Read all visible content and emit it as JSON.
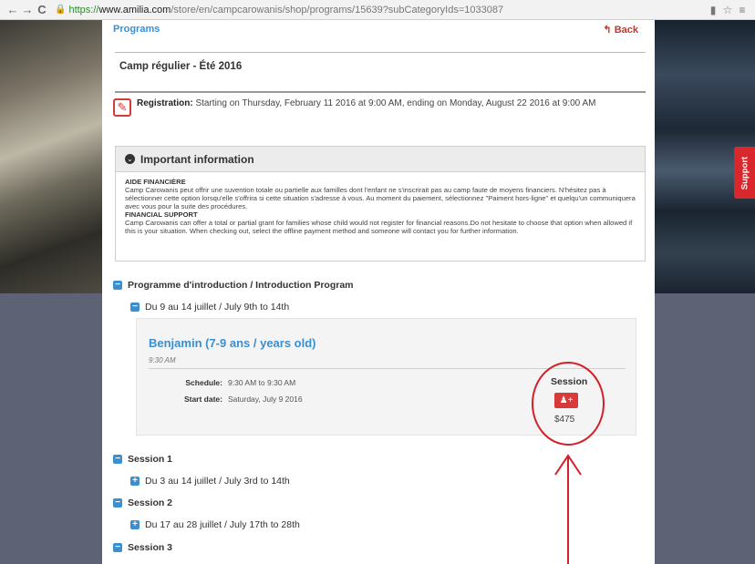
{
  "browser": {
    "back_glyph": "←",
    "forward_glyph": "→",
    "reload_glyph": "C",
    "url_https": "https://",
    "url_host": "www.amilia.com",
    "url_path": "/store/en/campcarowanis/shop/programs/15639?subCategoryIds=1033087",
    "ext_glyph": "▮",
    "star_glyph": "☆",
    "menu_glyph": "≡"
  },
  "page": {
    "programs_link": "Programs",
    "back_link": "↰ Back",
    "camp_title": "Camp régulier - Été 2016",
    "registration_label": "Registration:",
    "registration_text": "Starting on Thursday, February 11 2016 at 9:00 AM, ending on Monday, August 22 2016 at 9:00 AM"
  },
  "important_info": {
    "title": "Important information",
    "heading_fr": "AIDE FINANCIÈRE",
    "text_fr": "Camp Carowanis peut offrir une suvention totale ou partielle aux familles dont l'enfant ne s'inscrirait pas au camp faute de moyens financiers. N'hésitez pas à sélectionner cette option lorsqu'elle s'offrira si cette situation s'adresse à vous. Au moment du paiement, sélectionnez \"Paiment hors-ligne\" et quelqu'un communiquera avec vous pour la suite des procédures.",
    "heading_en": "FINANCIAL SUPPORT",
    "text_en": "Camp Carowanis can offer a total or partial grant for families whose child would not register for financial reasons.Do not hesitate to choose that option when allowed if this is your situation. When checking out, select the offline payment method and someone will contact you for further information."
  },
  "tree": {
    "intro_program": "Programme d'introduction / Introduction Program",
    "intro_dates": "Du 9 au 14 juillet / July 9th to 14th",
    "session1": "Session 1",
    "session1_dates": "Du 3 au 14 juillet / July 3rd to 14th",
    "session2": "Session 2",
    "session2_dates": "Du 17 au 28 juillet / July 17th to 28th",
    "session3": "Session 3",
    "collapse_glyph": "−",
    "expand_glyph": "+"
  },
  "activity": {
    "name": "Benjamin (7-9 ans / years old)",
    "time": "9:30 AM",
    "schedule_label": "Schedule:",
    "schedule_value": "9:30 AM to 9:30 AM",
    "start_label": "Start date:",
    "start_value": "Saturday, July 9 2016",
    "session_label": "Session",
    "price": "$475"
  },
  "support_tab": "Support",
  "icons": {
    "register_icon": "user-plus-icon",
    "registration_icon": "edit-icon",
    "info_icon": "chevron-circle-down-icon"
  },
  "colors": {
    "link_blue": "#3a8fd1",
    "accent_red": "#d83a3a",
    "annotation_red": "#d3202a"
  }
}
